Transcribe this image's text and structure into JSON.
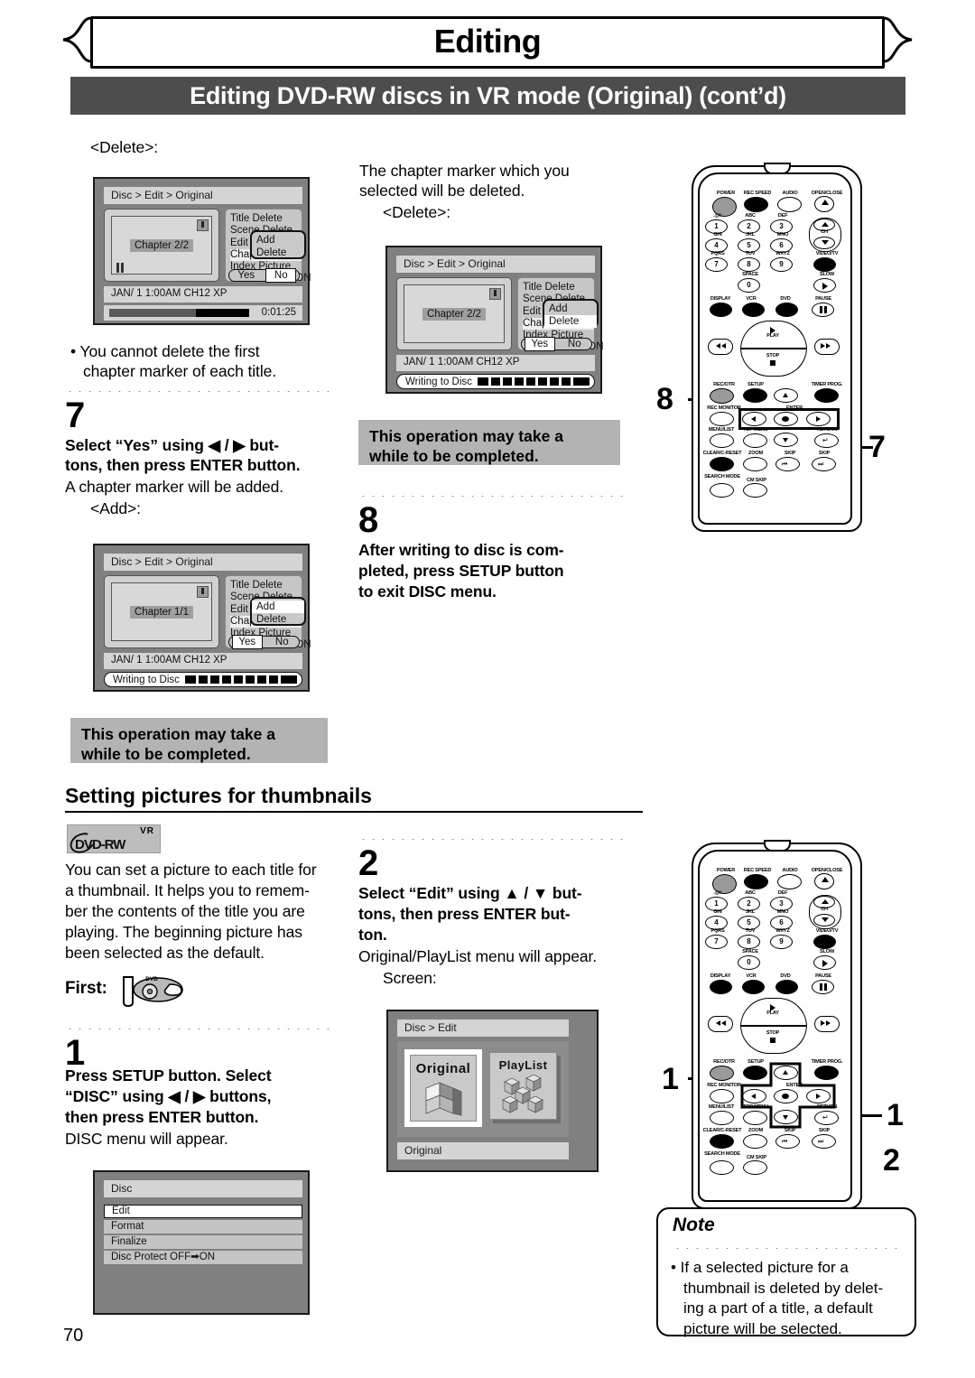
{
  "header": {
    "title": "Editing",
    "subtitle": "Editing DVD-RW discs in VR mode (Original) (cont’d)"
  },
  "page_number": "70",
  "left_column": {
    "delete_label": "<Delete>:",
    "bullet": "• You cannot delete the first",
    "bullet2": "chapter marker of each title.",
    "step7_num": "7",
    "step7_bold": "Select “Yes” using ◀ / ▶ but-",
    "step7_bold2": "tons, then press ENTER button.",
    "step7_plain": "A chapter marker will be added.",
    "add_label": "<Add>:",
    "note_band": "This operation may take a",
    "note_band2": "while to be completed."
  },
  "middle_column": {
    "intro1": "The chapter marker which you",
    "intro2": "selected will be deleted.",
    "delete_label": "<Delete>:",
    "note_band": "This operation may take a",
    "note_band2": "while to be completed.",
    "step8_num": "8",
    "step8_l1": "After writing to disc is com-",
    "step8_l2": "pleted, press SETUP button",
    "step8_l3": "to exit DISC menu.",
    "step2_num": "2",
    "step2_l1": "Select “Edit” using ▲ / ▼ but-",
    "step2_l2": "tons, then press ENTER but-",
    "step2_l3": "ton.",
    "step2_plain": "Original/PlayList menu will appear.",
    "screen_label": "Screen:"
  },
  "thumbnails_section": {
    "heading": "Setting pictures for thumbnails",
    "logo_vr": "VR",
    "logo_name": "DVD-RW",
    "body_l1": "You can set a picture to each title for",
    "body_l2": "a thumbnail. It helps you to remem-",
    "body_l3": "ber the contents of the title you are",
    "body_l4": "playing. The beginning picture has",
    "body_l5": "been selected as the default.",
    "first_label": "First:",
    "first_icon_text": "DVD",
    "step1_num": "1",
    "step1_l1": "Press SETUP button. Select",
    "step1_l2": "“DISC” using ◀ / ▶ buttons,",
    "step1_l3": "then press ENTER button.",
    "step1_plain": "DISC menu will appear."
  },
  "screens": {
    "delete_top": {
      "breadcrumb": "Disc > Edit > Original",
      "chapter": "Chapter 2/2",
      "menu": [
        "Title Delete",
        "Scene Delete",
        "Edit Title Name",
        "Chapter Mark",
        "Index Picture",
        "Protect OFF➡ON"
      ],
      "menu_selected_index": 3,
      "popup": [
        "Add",
        "Delete"
      ],
      "popup_selected": "",
      "yes": "Yes",
      "no": "No",
      "yn_selected": "No",
      "info": "JAN/ 1   1:00AM  CH12     XP",
      "time": "0:01:25",
      "progress_percent": 62
    },
    "delete_writing": {
      "breadcrumb": "Disc > Edit > Original",
      "chapter": "Chapter 2/2",
      "menu": [
        "Title Delete",
        "Scene Delete",
        "Edit Title Name",
        "Chapter Mark",
        "Index Picture",
        "Protect OFF➡ON"
      ],
      "menu_selected_index": 3,
      "popup": [
        "Add",
        "Delete"
      ],
      "popup_selected": "Delete",
      "yes": "Yes",
      "no": "No",
      "yn_selected": "Yes",
      "info": "JAN/ 1   1:00AM  CH12     XP",
      "writing": "Writing to Disc"
    },
    "add_writing": {
      "breadcrumb": "Disc > Edit > Original",
      "chapter": "Chapter 1/1",
      "menu": [
        "Title Delete",
        "Scene Delete",
        "Edit Title Name",
        "Chapter Mark",
        "Index Picture",
        "Protect OFF➡ON"
      ],
      "menu_selected_index": 3,
      "popup": [
        "Add",
        "Delete"
      ],
      "popup_selected": "Add",
      "yes": "Yes",
      "no": "No",
      "yn_selected": "Yes",
      "info": "JAN/ 1   1:00AM  CH12     XP",
      "writing": "Writing to Disc"
    },
    "disc_menu": {
      "title": "Disc",
      "items": [
        "Edit",
        "Format",
        "Finalize",
        "Disc Protect OFF➡ON"
      ],
      "selected_index": 0
    },
    "original_playlist": {
      "breadcrumb": "Disc > Edit",
      "tile_original": "Original",
      "tile_playlist": "PlayList",
      "footer": "Original",
      "selected": "Original"
    }
  },
  "note": {
    "title": "Note",
    "l1": "• If a selected picture for a",
    "l2": "thumbnail is deleted by delet-",
    "l3": "ing a part of a title, a default",
    "l4": "picture will be selected."
  },
  "callouts": {
    "top_left": "8",
    "top_right": "7",
    "bottom_left": "1",
    "bottom_right_1": "1",
    "bottom_right_2": "2"
  },
  "remote": {
    "labels": {
      "power": "POWER",
      "rec_speed": "REC SPEED",
      "audio": "AUDIO",
      "open_close": "OPEN/CLOSE",
      "k1": ".@/:",
      "k2": "ABC",
      "k3": "DEF",
      "k4": "GHI",
      "k5": "JKL",
      "k6": "MNO",
      "k7": "PQRS",
      "k8": "TUV",
      "k9": "WXYZ",
      "k0": "SPACE",
      "ch": "CH",
      "video_tv": "VIDEO/TV",
      "slow": "SLOW",
      "display": "DISPLAY",
      "vcr": "VCR",
      "dvd": "DVD",
      "pause": "PAUSE",
      "play": "PLAY",
      "stop": "STOP",
      "rec_otr": "REC/OTR",
      "setup": "SETUP",
      "timer_prog": "TIMER PROG.",
      "rec_monitor": "REC MONITOR",
      "enter": "ENTER",
      "menu_list": "MENU/LIST",
      "top_menu": "TOP MENU",
      "return": "RETURN",
      "clear_c_reset": "CLEAR/C-RESET",
      "zoom": "ZOOM",
      "skip_back": "SKIP",
      "skip_fwd": "SKIP",
      "search_mode": "SEARCH MODE",
      "cm_skip": "CM SKIP"
    },
    "numbers": {
      "n1": "1",
      "n2": "2",
      "n3": "3",
      "n4": "4",
      "n5": "5",
      "n6": "6",
      "n7": "7",
      "n8": "8",
      "n9": "9",
      "n0": "0"
    }
  }
}
